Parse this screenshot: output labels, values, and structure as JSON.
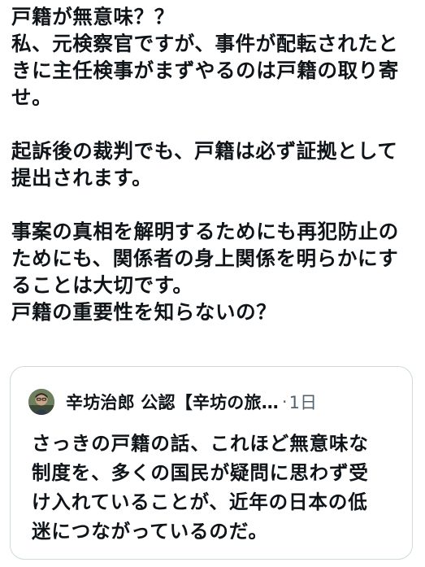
{
  "tweet": {
    "lines": [
      "戸籍が無意味？？",
      "私、元検察官ですが、事件が配転されたと",
      "きに主任検事がまずやるのは戸籍の取り寄",
      "せ。",
      "",
      "起訴後の裁判でも、戸籍は必ず証拠として",
      "提出されます。",
      "",
      "事案の真相を解明するためにも再犯防止の",
      "ためにも、関係者の身上関係を明らかにす",
      "ることは大切です。",
      "戸籍の重要性を知らないの？"
    ]
  },
  "quote": {
    "author_name": "辛坊治郎 公認【辛坊の旅…",
    "dot": "·",
    "time": "1日",
    "avatar_icon": "user-avatar-photo",
    "lines": [
      "さっきの戸籍の話、これほど無意味な",
      "制度を、多くの国民が疑問に思わず受",
      "け入れていることが、近年の日本の低",
      "迷につながっているのだ。"
    ]
  }
}
